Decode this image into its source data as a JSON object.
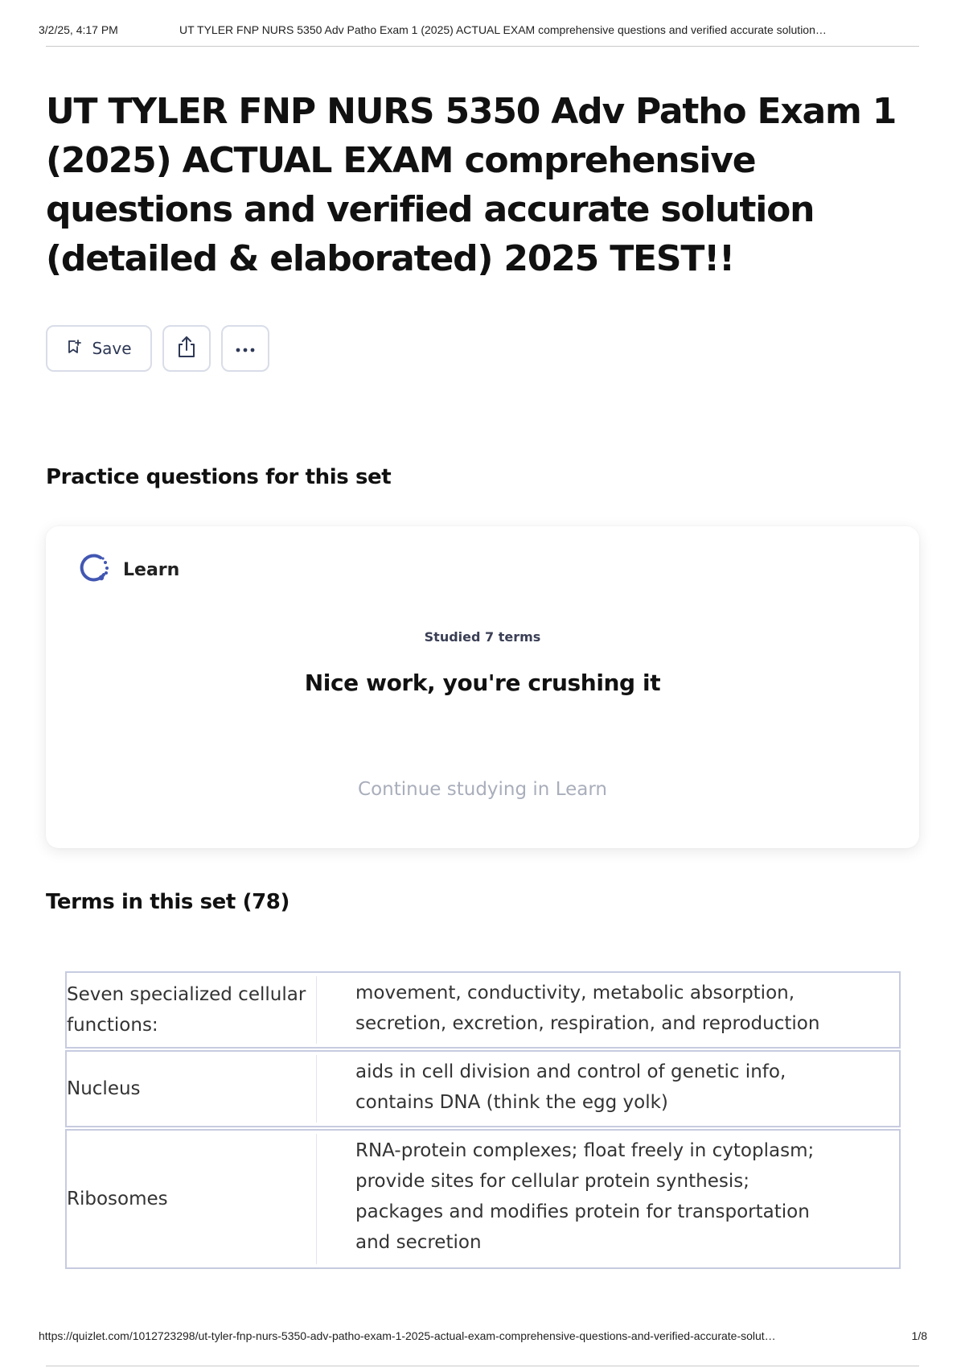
{
  "print_header": {
    "date": "3/2/25, 4:17 PM",
    "doc_title": "UT TYLER FNP NURS 5350 Adv Patho Exam 1 (2025) ACTUAL EXAM comprehensive questions and verified accurate solution…"
  },
  "page": {
    "title": "UT TYLER FNP NURS 5350 Adv Patho Exam 1 (2025) ACTUAL EXAM comprehensive questions and verified accurate solution (detailed & elaborated) 2025 TEST!!"
  },
  "actions": {
    "save_label": "Save",
    "save_icon": "bookmark-add-icon",
    "share_icon": "share-icon",
    "more_icon": "more-options-icon"
  },
  "practice": {
    "heading": "Practice questions for this set",
    "card": {
      "mode_label": "Learn",
      "mode_icon": "learn-progress-icon",
      "studied_text": "Studied 7 terms",
      "praise_text": "Nice work, you're crushing it",
      "continue_label": "Continue studying in Learn"
    }
  },
  "terms": {
    "heading": "Terms in this set (78)",
    "rows": [
      {
        "term": "Seven specialized cellular functions:",
        "definition": "movement, conductivity, metabolic absorption, secretion, excretion, respiration, and reproduction"
      },
      {
        "term": "Nucleus",
        "definition": "aids in cell division and control of genetic info, contains DNA (think the egg yolk)"
      },
      {
        "term": "Ribosomes",
        "definition": "RNA-protein complexes; float freely in cytoplasm; provide sites for cellular protein synthesis; packages and modifies protein for transportation and secretion"
      }
    ]
  },
  "print_footer": {
    "url": "https://quizlet.com/1012723298/ut-tyler-fnp-nurs-5350-adv-patho-exam-1-2025-actual-exam-comprehensive-questions-and-verified-accurate-solut…",
    "page_number": "1/8"
  },
  "colors": {
    "learn_icon": "#4257b2",
    "button_border": "#d9dde8",
    "table_border": "#c7cbe0",
    "muted_link": "#a9aebb"
  }
}
